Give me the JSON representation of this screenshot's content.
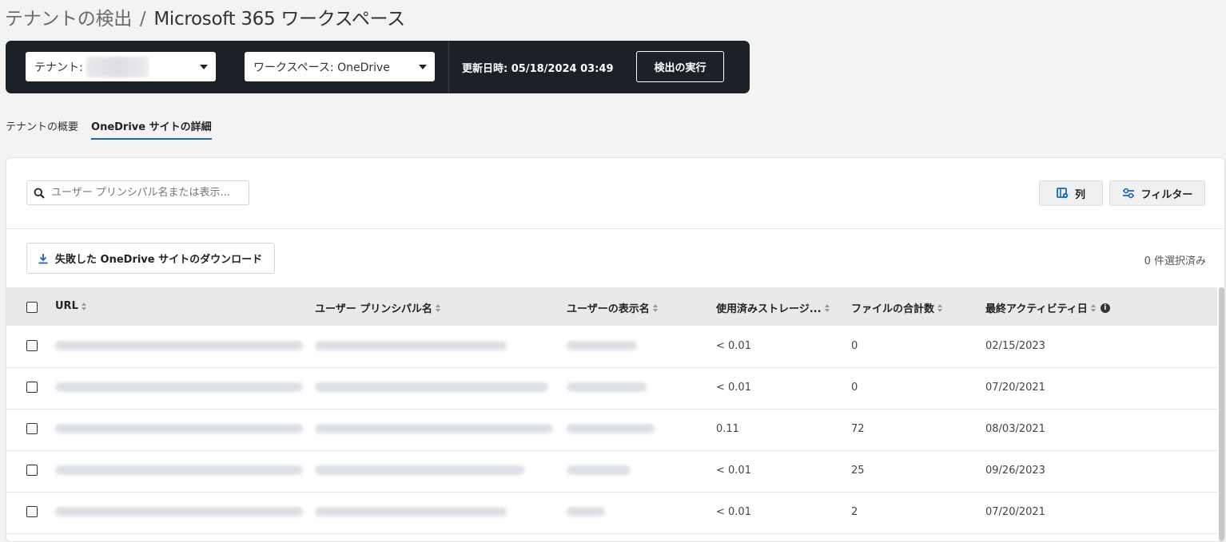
{
  "breadcrumb": {
    "parent": "テナントの検出",
    "separator": "/",
    "current": "Microsoft 365 ワークスペース"
  },
  "topbar": {
    "tenant_label": "テナント:",
    "workspace_label": "ワークスペース: OneDrive",
    "updated": "更新日時: 05/18/2024 03:49",
    "run_button": "検出の実行"
  },
  "tabs": [
    {
      "label": "テナントの概要",
      "active": false
    },
    {
      "label": "OneDrive サイトの詳細",
      "active": true
    }
  ],
  "toolbar": {
    "search_placeholder": "ユーザー プリンシパル名または表示...",
    "columns_button": "列",
    "filter_button": "フィルター",
    "download_button": "失敗した OneDrive サイトのダウンロード",
    "selected_count": "0 件選択済み"
  },
  "table": {
    "columns": [
      "URL",
      "ユーザー プリンシパル名",
      "ユーザーの表示名",
      "使用済みストレージ...",
      "ファイルの合計数",
      "最終アクティビティ日"
    ],
    "rows": [
      {
        "storage": "< 0.01",
        "files": "0",
        "last_activity": "02/15/2023"
      },
      {
        "storage": "< 0.01",
        "files": "0",
        "last_activity": "07/20/2021"
      },
      {
        "storage": "0.11",
        "files": "72",
        "last_activity": "08/03/2021"
      },
      {
        "storage": "< 0.01",
        "files": "25",
        "last_activity": "09/26/2023"
      },
      {
        "storage": "< 0.01",
        "files": "2",
        "last_activity": "07/20/2021"
      }
    ]
  },
  "colors": {
    "topbar_bg": "#1c2127",
    "accent": "#1a66b3"
  }
}
